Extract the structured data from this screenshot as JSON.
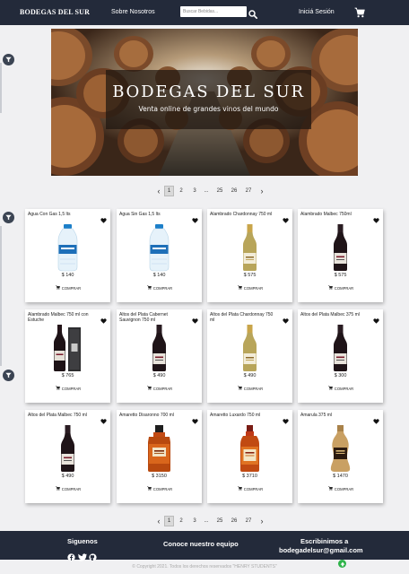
{
  "navbar": {
    "brand": "BODEGAS DEL SUR",
    "about_label": "Sobre Nosotros",
    "search_placeholder": "Buscar Bebidas...",
    "login_label": "Iniciá Sesión"
  },
  "hero": {
    "title": "BODEGAS DEL SUR",
    "subtitle": "Venta online de grandes vinos del mundo"
  },
  "pagination": {
    "prev": "‹",
    "pages": [
      "1",
      "2",
      "3",
      "...",
      "25",
      "26",
      "27"
    ],
    "active": "1",
    "next": "›"
  },
  "buy_label": "COMPRAR",
  "products": [
    {
      "name": "Agua Con Gas 1,5 lts",
      "price": "$ 140",
      "kind": "water-bottle"
    },
    {
      "name": "Agua Sin Gas 1,5 lts",
      "price": "$ 140",
      "kind": "water-bottle"
    },
    {
      "name": "Alambrado Chardonnay 750 ml",
      "price": "$ 575",
      "kind": "white-wine"
    },
    {
      "name": "Alambrado Malbec 750ml",
      "price": "$ 575",
      "kind": "red-wine"
    },
    {
      "name": "Alambrado Malbec 750 ml con Estuche",
      "price": "$ 765",
      "kind": "wine-box"
    },
    {
      "name": "Altos del Plata Cabernet Sauvignon 750 ml",
      "price": "$ 490",
      "kind": "red-wine"
    },
    {
      "name": "Altos del Plata Chardonnay 750 ml",
      "price": "$ 490",
      "kind": "white-wine"
    },
    {
      "name": "Altos del Plata Malbec 375 ml",
      "price": "$ 300",
      "kind": "red-wine"
    },
    {
      "name": "Altos del Plata Malbec 750 ml",
      "price": "$ 490",
      "kind": "red-wine"
    },
    {
      "name": "Amaretto Disaronno 700 ml",
      "price": "$ 3150",
      "kind": "amaretto"
    },
    {
      "name": "Amaretto Luxardo 750 ml",
      "price": "$ 3710",
      "kind": "amaretto-tall"
    },
    {
      "name": "Amarula 375 ml",
      "price": "$ 1470",
      "kind": "amarula"
    }
  ],
  "footer": {
    "social_title": "Siguenos",
    "team_title": "Conoce nuestro equipo",
    "contact_title": "Escribinimos a",
    "contact_email": "bodegadelsur@gmail.com",
    "copyright": "© Copyright 2021. Todos los derechos reservados \"HENRY STUDENTS\""
  },
  "icons": {
    "search": "search-icon",
    "cart": "cart-icon",
    "filter": "filter-icon",
    "favorite": "heart-icon",
    "facebook": "facebook-icon",
    "twitter": "twitter-icon",
    "github": "github-icon",
    "scroll_top": "arrow-up-icon"
  },
  "colors": {
    "navbar": "#232a3a",
    "filter_button": "#3b4453",
    "scroll_top": "#2fb34a"
  }
}
